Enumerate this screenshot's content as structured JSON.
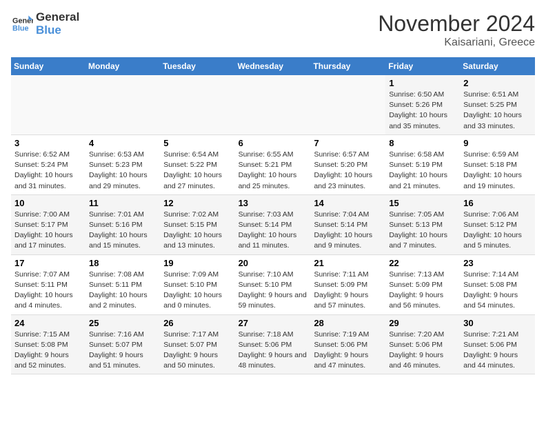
{
  "logo": {
    "line1": "General",
    "line2": "Blue"
  },
  "header": {
    "month": "November 2024",
    "location": "Kaisariani, Greece"
  },
  "weekdays": [
    "Sunday",
    "Monday",
    "Tuesday",
    "Wednesday",
    "Thursday",
    "Friday",
    "Saturday"
  ],
  "weeks": [
    [
      {
        "day": "",
        "info": ""
      },
      {
        "day": "",
        "info": ""
      },
      {
        "day": "",
        "info": ""
      },
      {
        "day": "",
        "info": ""
      },
      {
        "day": "",
        "info": ""
      },
      {
        "day": "1",
        "info": "Sunrise: 6:50 AM\nSunset: 5:26 PM\nDaylight: 10 hours and 35 minutes."
      },
      {
        "day": "2",
        "info": "Sunrise: 6:51 AM\nSunset: 5:25 PM\nDaylight: 10 hours and 33 minutes."
      }
    ],
    [
      {
        "day": "3",
        "info": "Sunrise: 6:52 AM\nSunset: 5:24 PM\nDaylight: 10 hours and 31 minutes."
      },
      {
        "day": "4",
        "info": "Sunrise: 6:53 AM\nSunset: 5:23 PM\nDaylight: 10 hours and 29 minutes."
      },
      {
        "day": "5",
        "info": "Sunrise: 6:54 AM\nSunset: 5:22 PM\nDaylight: 10 hours and 27 minutes."
      },
      {
        "day": "6",
        "info": "Sunrise: 6:55 AM\nSunset: 5:21 PM\nDaylight: 10 hours and 25 minutes."
      },
      {
        "day": "7",
        "info": "Sunrise: 6:57 AM\nSunset: 5:20 PM\nDaylight: 10 hours and 23 minutes."
      },
      {
        "day": "8",
        "info": "Sunrise: 6:58 AM\nSunset: 5:19 PM\nDaylight: 10 hours and 21 minutes."
      },
      {
        "day": "9",
        "info": "Sunrise: 6:59 AM\nSunset: 5:18 PM\nDaylight: 10 hours and 19 minutes."
      }
    ],
    [
      {
        "day": "10",
        "info": "Sunrise: 7:00 AM\nSunset: 5:17 PM\nDaylight: 10 hours and 17 minutes."
      },
      {
        "day": "11",
        "info": "Sunrise: 7:01 AM\nSunset: 5:16 PM\nDaylight: 10 hours and 15 minutes."
      },
      {
        "day": "12",
        "info": "Sunrise: 7:02 AM\nSunset: 5:15 PM\nDaylight: 10 hours and 13 minutes."
      },
      {
        "day": "13",
        "info": "Sunrise: 7:03 AM\nSunset: 5:14 PM\nDaylight: 10 hours and 11 minutes."
      },
      {
        "day": "14",
        "info": "Sunrise: 7:04 AM\nSunset: 5:14 PM\nDaylight: 10 hours and 9 minutes."
      },
      {
        "day": "15",
        "info": "Sunrise: 7:05 AM\nSunset: 5:13 PM\nDaylight: 10 hours and 7 minutes."
      },
      {
        "day": "16",
        "info": "Sunrise: 7:06 AM\nSunset: 5:12 PM\nDaylight: 10 hours and 5 minutes."
      }
    ],
    [
      {
        "day": "17",
        "info": "Sunrise: 7:07 AM\nSunset: 5:11 PM\nDaylight: 10 hours and 4 minutes."
      },
      {
        "day": "18",
        "info": "Sunrise: 7:08 AM\nSunset: 5:11 PM\nDaylight: 10 hours and 2 minutes."
      },
      {
        "day": "19",
        "info": "Sunrise: 7:09 AM\nSunset: 5:10 PM\nDaylight: 10 hours and 0 minutes."
      },
      {
        "day": "20",
        "info": "Sunrise: 7:10 AM\nSunset: 5:10 PM\nDaylight: 9 hours and 59 minutes."
      },
      {
        "day": "21",
        "info": "Sunrise: 7:11 AM\nSunset: 5:09 PM\nDaylight: 9 hours and 57 minutes."
      },
      {
        "day": "22",
        "info": "Sunrise: 7:13 AM\nSunset: 5:09 PM\nDaylight: 9 hours and 56 minutes."
      },
      {
        "day": "23",
        "info": "Sunrise: 7:14 AM\nSunset: 5:08 PM\nDaylight: 9 hours and 54 minutes."
      }
    ],
    [
      {
        "day": "24",
        "info": "Sunrise: 7:15 AM\nSunset: 5:08 PM\nDaylight: 9 hours and 52 minutes."
      },
      {
        "day": "25",
        "info": "Sunrise: 7:16 AM\nSunset: 5:07 PM\nDaylight: 9 hours and 51 minutes."
      },
      {
        "day": "26",
        "info": "Sunrise: 7:17 AM\nSunset: 5:07 PM\nDaylight: 9 hours and 50 minutes."
      },
      {
        "day": "27",
        "info": "Sunrise: 7:18 AM\nSunset: 5:06 PM\nDaylight: 9 hours and 48 minutes."
      },
      {
        "day": "28",
        "info": "Sunrise: 7:19 AM\nSunset: 5:06 PM\nDaylight: 9 hours and 47 minutes."
      },
      {
        "day": "29",
        "info": "Sunrise: 7:20 AM\nSunset: 5:06 PM\nDaylight: 9 hours and 46 minutes."
      },
      {
        "day": "30",
        "info": "Sunrise: 7:21 AM\nSunset: 5:06 PM\nDaylight: 9 hours and 44 minutes."
      }
    ]
  ]
}
